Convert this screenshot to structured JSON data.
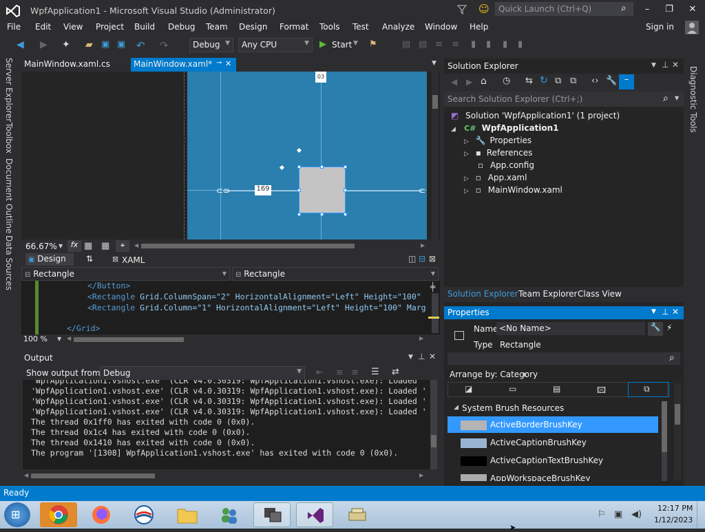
{
  "window": {
    "title": "WpfApplication1 - Microsoft Visual Studio (Administrator)",
    "quick_launch_placeholder": "Quick Launch (Ctrl+Q)",
    "sign_in": "Sign in"
  },
  "menu": [
    "File",
    "Edit",
    "View",
    "Project",
    "Build",
    "Debug",
    "Team",
    "Design",
    "Format",
    "Tools",
    "Test",
    "Analyze",
    "Window",
    "Help"
  ],
  "toolbar": {
    "config": "Debug",
    "platform": "Any CPU",
    "start": "Start"
  },
  "left_tabs": [
    "Server Explorer",
    "Toolbox",
    "Document Outline",
    "Data Sources"
  ],
  "doc_tabs": [
    {
      "label": "MainWindow.xaml.cs",
      "active": false
    },
    {
      "label": "MainWindow.xaml*",
      "active": true
    }
  ],
  "designer": {
    "top_marker": "03",
    "margin_label": "169",
    "zoom": "66.67%",
    "design_tab": "Design",
    "xaml_tab": "XAML",
    "breadcrumb_left": "Rectangle",
    "breadcrumb_right": "Rectangle",
    "xaml_zoom": "100 %"
  },
  "xaml_lines": [
    {
      "tag": "</Button>",
      "rest": ""
    },
    {
      "tag": "<Rectangle",
      "rest": " Grid.ColumnSpan=\"2\" HorizontalAlignment=\"Left\" Height=\"100\""
    },
    {
      "tag": "<Rectangle",
      "rest": " Grid.Column=\"1\" HorizontalAlignment=\"Left\" Height=\"100\" Marg"
    },
    {
      "tag": "</Grid>",
      "rest": ""
    }
  ],
  "output": {
    "title": "Output",
    "show_from_label": "Show output from:",
    "show_from_value": "Debug",
    "lines": [
      "'WpfApplication1.vshost.exe' (CLR v4.0.30319: WpfApplication1.vshost.exe): Loaded '",
      "'WpfApplication1.vshost.exe' (CLR v4.0.30319: WpfApplication1.vshost.exe): Loaded '",
      "'WpfApplication1.vshost.exe' (CLR v4.0.30319: WpfApplication1.vshost.exe): Loaded '",
      "'WpfApplication1.vshost.exe' (CLR v4.0.30319: WpfApplication1.vshost.exe): Loaded '",
      "The thread 0x1ff0 has exited with code 0 (0x0).",
      "The thread 0x1c4 has exited with code 0 (0x0).",
      "The thread 0x1410 has exited with code 0 (0x0).",
      "The program '[1308] WpfApplication1.vshost.exe' has exited with code 0 (0x0)."
    ]
  },
  "solution_explorer": {
    "title": "Solution Explorer",
    "search_placeholder": "Search Solution Explorer (Ctrl+;)",
    "solution": "Solution 'WpfApplication1' (1 project)",
    "project": "WpfApplication1",
    "items": [
      "Properties",
      "References",
      "App.config",
      "App.xaml",
      "MainWindow.xaml"
    ],
    "tabs": [
      "Solution Explorer",
      "Team Explorer",
      "Class View"
    ]
  },
  "properties": {
    "title": "Properties",
    "name_label": "Name",
    "name_value": "<No Name>",
    "type_label": "Type",
    "type_value": "Rectangle",
    "arrange_by": "Arrange by: Category",
    "section": "System Brush Resources",
    "brushes": [
      {
        "name": "ActiveBorderBrushKey",
        "color": "#b4b4b4",
        "selected": true
      },
      {
        "name": "ActiveCaptionBrushKey",
        "color": "#99b4d1",
        "selected": false
      },
      {
        "name": "ActiveCaptionTextBrushKey",
        "color": "#000000",
        "selected": false
      },
      {
        "name": "AppWorkspaceBrushKey",
        "color": "#ababab",
        "selected": false
      }
    ]
  },
  "status": {
    "text": "Ready"
  },
  "taskbar": {
    "time": "12:17 PM",
    "date": "1/12/2023"
  },
  "colors": {
    "accent": "#007acc",
    "canvas": "#2a7fae",
    "selection": "#3399ff"
  }
}
